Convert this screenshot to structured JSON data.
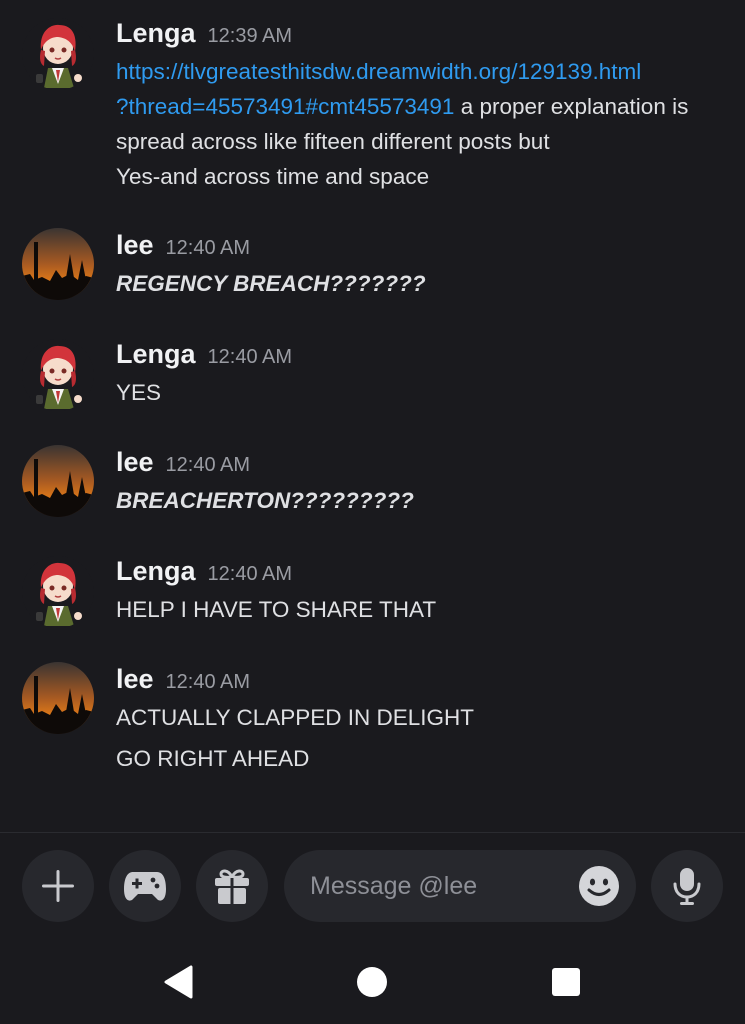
{
  "messages": [
    {
      "author": "Lenga",
      "time": "12:39 AM",
      "lines": [
        {
          "link": "https://tlvgreatesthitsdw.dreamwidth.org/129139.html"
        },
        {
          "link": "?thread=45573491#cmt45573491",
          "text": " a proper explanation is"
        },
        {
          "text": "spread across like fifteen different posts but"
        },
        {
          "text": "Yes-and across time and space"
        }
      ]
    },
    {
      "author": "lee",
      "time": "12:40 AM",
      "lines": [
        {
          "text": "REGENCY BREACH???????"
        }
      ]
    },
    {
      "author": "Lenga",
      "time": "12:40 AM",
      "lines": [
        {
          "text": "YES"
        }
      ]
    },
    {
      "author": "lee",
      "time": "12:40 AM",
      "lines": [
        {
          "text": "BREACHERTON?????????"
        }
      ]
    },
    {
      "author": "Lenga",
      "time": "12:40 AM",
      "lines": [
        {
          "text": "HELP I HAVE TO SHARE THAT"
        }
      ]
    },
    {
      "author": "lee",
      "time": "12:40 AM",
      "lines": [
        {
          "text": "ACTUALLY CLAPPED IN DELIGHT"
        },
        {
          "text": "GO RIGHT AHEAD"
        }
      ]
    }
  ],
  "composer": {
    "placeholder": "Message @lee",
    "icons": [
      "plus-icon",
      "gamepad-icon",
      "gift-icon",
      "emoji-icon",
      "microphone-icon"
    ]
  },
  "navbar": {
    "icons": [
      "back-icon",
      "home-icon",
      "recents-icon"
    ]
  },
  "colors": {
    "background": "#1a1a1e",
    "link": "#2f9bf0",
    "timestamp": "#9a9ca3",
    "button": "#27282d"
  }
}
